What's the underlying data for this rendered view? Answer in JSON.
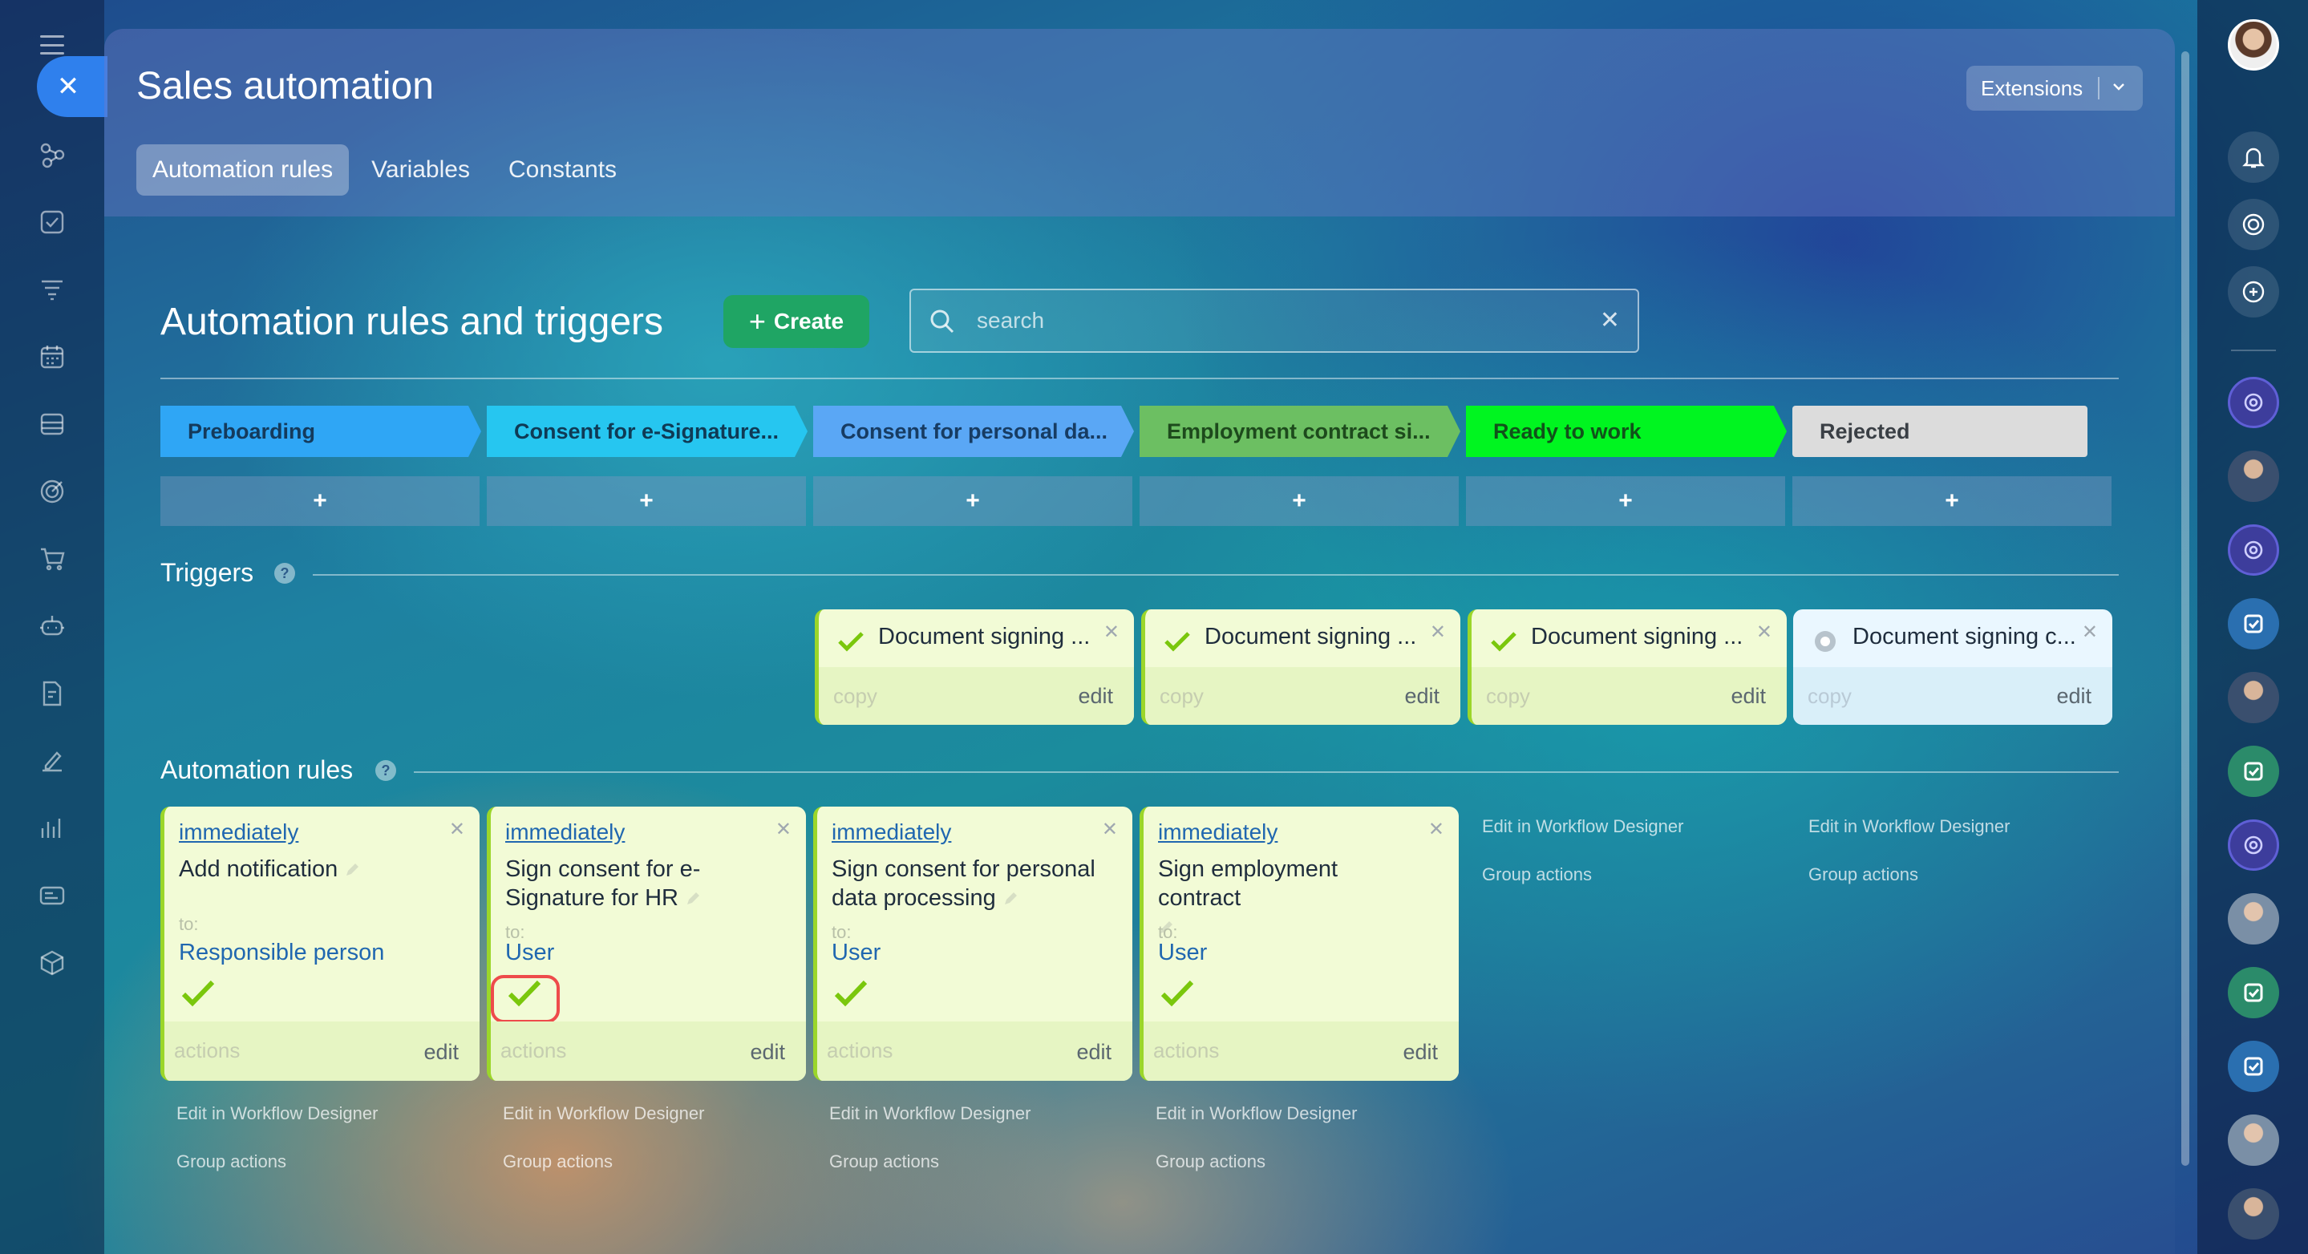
{
  "app": {
    "title": "Sales automation",
    "extensions_label": "Extensions"
  },
  "tabs": [
    {
      "label": "Automation rules",
      "active": true
    },
    {
      "label": "Variables",
      "active": false
    },
    {
      "label": "Constants",
      "active": false
    }
  ],
  "toolbar": {
    "section_title": "Automation rules and triggers",
    "create_label": "Create"
  },
  "search": {
    "placeholder": "search",
    "value": ""
  },
  "stages": [
    {
      "label": "Preboarding",
      "color": "#2fa6f5",
      "text_color": "#143a5c"
    },
    {
      "label": "Consent for e-Signature...",
      "color": "#26c6f0",
      "text_color": "#0f3a55"
    },
    {
      "label": "Consent for personal da...",
      "color": "#5aa7f5",
      "text_color": "#173c63"
    },
    {
      "label": "Employment contract si...",
      "color": "#6cbf62",
      "text_color": "#1d4a1c"
    },
    {
      "label": "Ready to work",
      "color": "#00f520",
      "text_color": "#11521a"
    },
    {
      "label": "Rejected",
      "color": "#dcdcdc",
      "text_color": "#3a3f45"
    }
  ],
  "add_label": "+",
  "sections": {
    "triggers": "Triggers",
    "rules": "Automation rules",
    "help": "?"
  },
  "triggers": [
    {
      "label": "Document signing ...",
      "status": "done",
      "copy": "copy",
      "edit": "edit"
    },
    {
      "label": "Document signing ...",
      "status": "done",
      "copy": "copy",
      "edit": "edit"
    },
    {
      "label": "Document signing ...",
      "status": "done",
      "copy": "copy",
      "edit": "edit"
    },
    {
      "label": "Document signing c...",
      "status": "pending",
      "copy": "copy",
      "edit": "edit"
    }
  ],
  "rules": [
    {
      "when": "immediately",
      "name": "Add notification",
      "to_label": "to:",
      "to": "Responsible person",
      "actions": "actions",
      "edit": "edit"
    },
    {
      "when": "immediately",
      "name": "Sign consent for e-Signature for HR",
      "to_label": "to:",
      "to": "User",
      "actions": "actions",
      "edit": "edit",
      "highlighted": true
    },
    {
      "when": "immediately",
      "name": "Sign consent for personal data processing",
      "to_label": "to:",
      "to": "User",
      "actions": "actions",
      "edit": "edit"
    },
    {
      "when": "immediately",
      "name": "Sign employment contract",
      "to_label": "to:",
      "to": "User",
      "actions": "actions",
      "edit": "edit"
    }
  ],
  "column_links": {
    "designer": "Edit in Workflow Designer",
    "group": "Group actions"
  },
  "colors": {
    "accent": "#2f80ed",
    "create": "#1fa564",
    "highlight": "#ee4b4b",
    "check": "#7ac70c"
  }
}
